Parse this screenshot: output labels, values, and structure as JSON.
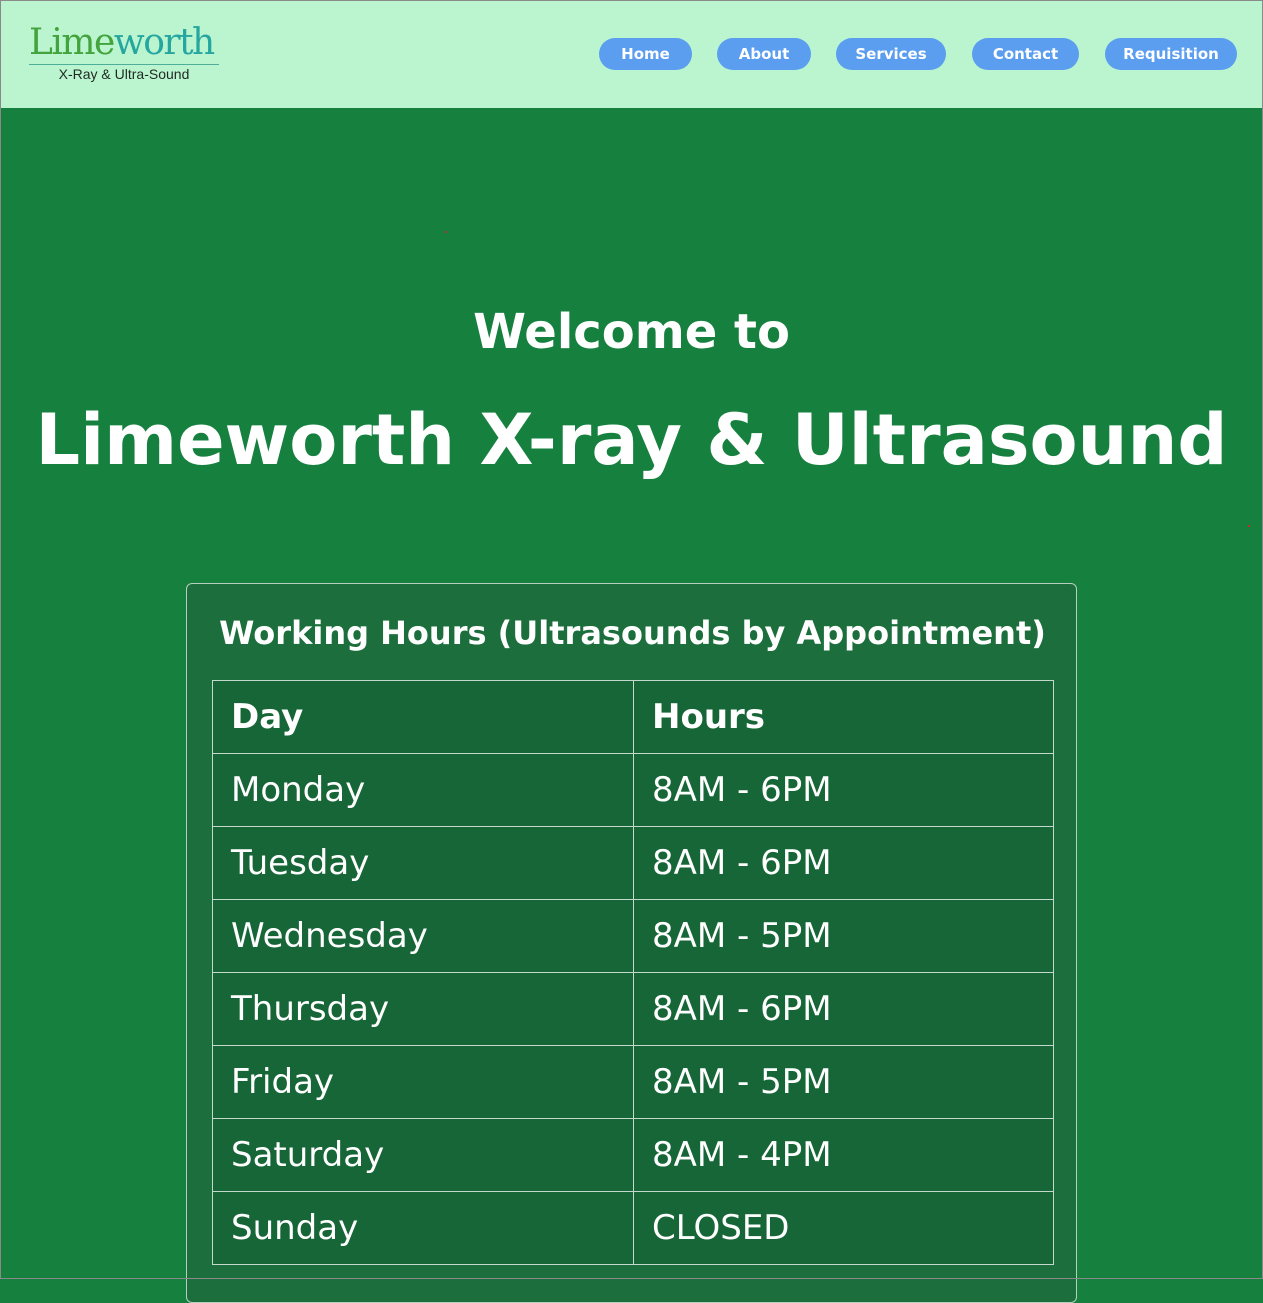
{
  "brand": {
    "name_part1": "Lime",
    "name_part2": "worth",
    "tagline": "X-Ray & Ultra-Sound",
    "colors": {
      "lime": "#43a33c",
      "teal": "#25a7a0"
    }
  },
  "nav": {
    "items": [
      {
        "label": "Home"
      },
      {
        "label": "About"
      },
      {
        "label": "Services"
      },
      {
        "label": "Contact"
      },
      {
        "label": "Requisition"
      }
    ],
    "button_color": "#5b9ef0",
    "header_bg": "#bbf5d0"
  },
  "hero": {
    "welcome": "Welcome to",
    "title": "Limeworth X-ray & Ultrasound",
    "bg_color": "#16813f"
  },
  "hours": {
    "title": "Working Hours (Ultrasounds by Appointment)",
    "headers": [
      "Day",
      "Hours"
    ],
    "rows": [
      [
        "Monday",
        "8AM - 6PM"
      ],
      [
        "Tuesday",
        "8AM - 6PM"
      ],
      [
        "Wednesday",
        "8AM - 5PM"
      ],
      [
        "Thursday",
        "8AM - 6PM"
      ],
      [
        "Friday",
        "8AM - 5PM"
      ],
      [
        "Saturday",
        "8AM - 4PM"
      ],
      [
        "Sunday",
        "CLOSED"
      ]
    ]
  }
}
